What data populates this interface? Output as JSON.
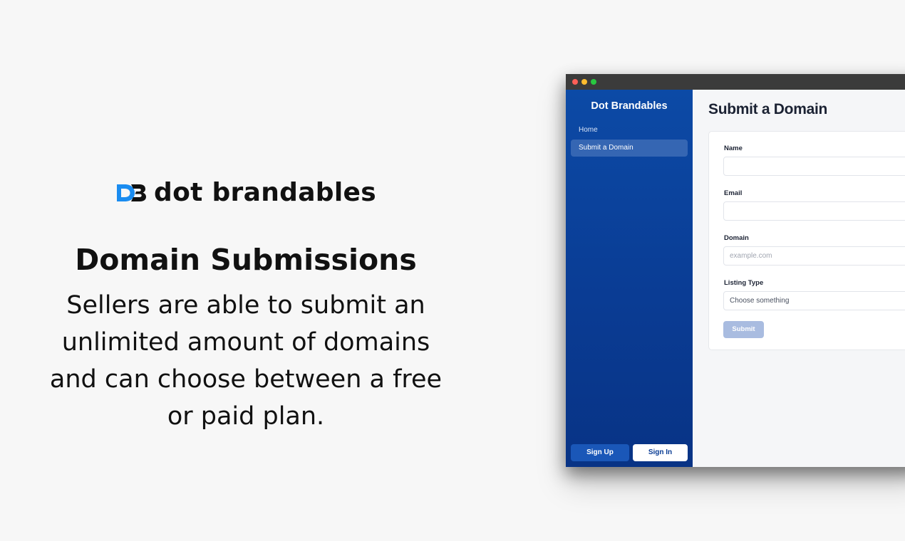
{
  "promo": {
    "brand_name": "dot brandables",
    "headline": "Domain Submissions",
    "description": "Sellers are able to submit an unlimited amount of domains and can choose between a free or paid plan."
  },
  "app": {
    "sidebar": {
      "title": "Dot Brandables",
      "items": [
        {
          "label": "Home",
          "active": false
        },
        {
          "label": "Submit a Domain",
          "active": true
        }
      ],
      "sign_up_label": "Sign Up",
      "sign_in_label": "Sign In"
    },
    "page_title": "Submit a Domain",
    "form": {
      "name": {
        "label": "Name",
        "value": ""
      },
      "email": {
        "label": "Email",
        "value": ""
      },
      "domain": {
        "label": "Domain",
        "value": "",
        "placeholder": "example.com"
      },
      "listing_type": {
        "label": "Listing Type",
        "selected": "Choose something"
      },
      "submit_label": "Submit"
    }
  },
  "colors": {
    "sidebar": "#0a3c94",
    "accent": "#1a57b8",
    "logo_blue": "#1a8cf0",
    "submit_disabled": "#a9bce0"
  },
  "icons": [
    "db-logo-icon"
  ]
}
